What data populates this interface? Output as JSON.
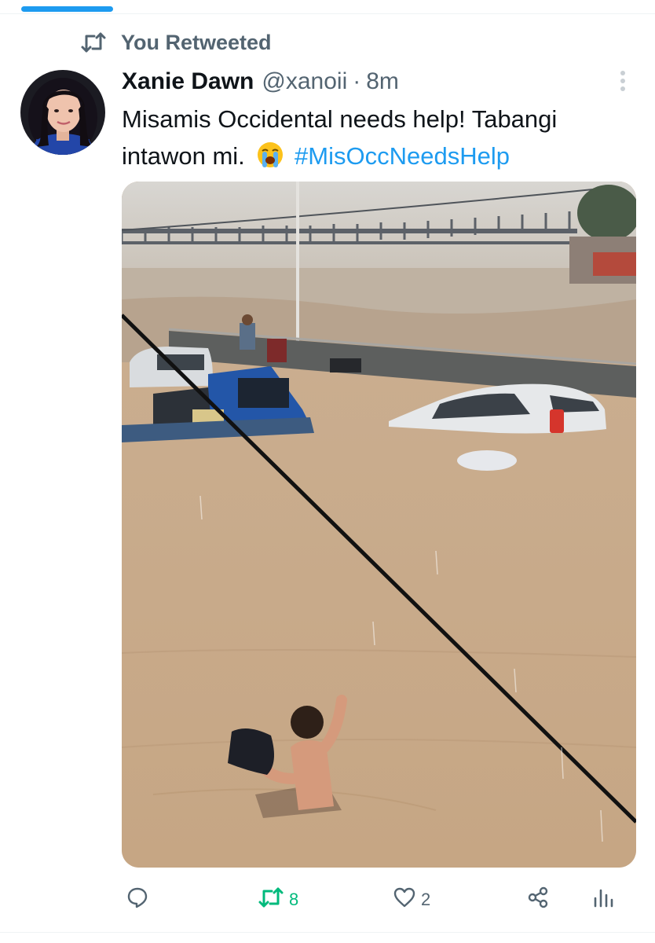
{
  "retweet_context": {
    "label": "You Retweeted",
    "icon": "retweet-icon"
  },
  "tweet": {
    "author_name": "Xanie Dawn",
    "author_handle": "@xanoii",
    "separator": "·",
    "time": "8m",
    "text_before_emoji": "Misamis Occidental needs help! Tabangi intawon mi.",
    "emoji": "loudly-crying-face",
    "hashtag": "#MisOccNeedsHelp"
  },
  "actions": {
    "reply": {
      "icon": "reply-icon",
      "count": ""
    },
    "retweet": {
      "icon": "retweet-icon",
      "count": "8",
      "active_color": "#00ba7c"
    },
    "like": {
      "icon": "heart-icon",
      "count": "2"
    },
    "share": {
      "icon": "share-icon"
    },
    "analytics": {
      "icon": "analytics-icon"
    }
  },
  "colors": {
    "accent": "#1d9bf0",
    "secondary_text": "#536471",
    "retweet_green": "#00ba7c"
  }
}
